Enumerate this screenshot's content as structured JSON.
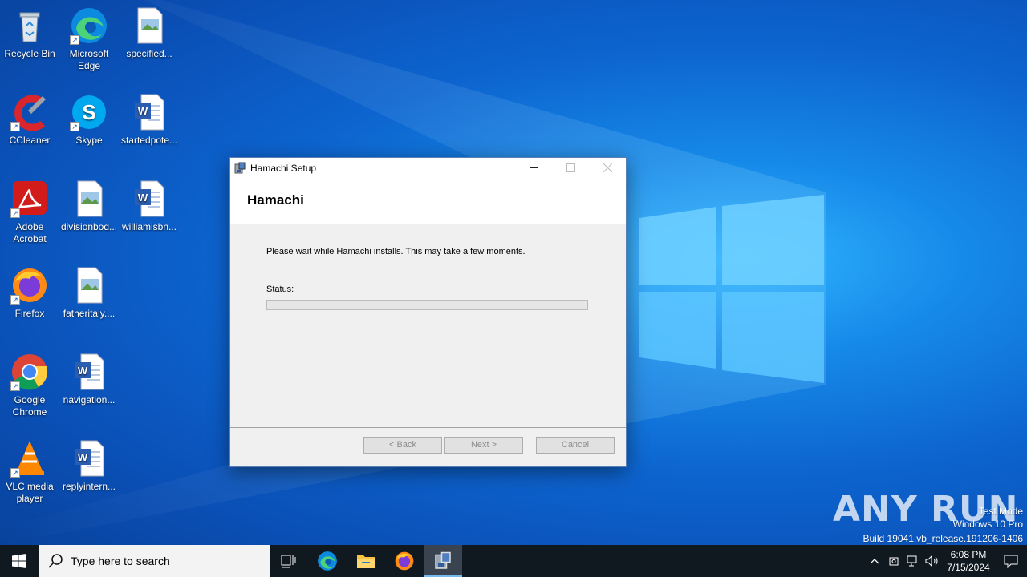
{
  "desktop": {
    "icons": [
      {
        "label": "Recycle Bin",
        "icon": "recycle-bin-icon"
      },
      {
        "label": "Microsoft Edge",
        "icon": "edge-icon"
      },
      {
        "label": "specified...",
        "icon": "image-file-icon"
      },
      {
        "label": "CCleaner",
        "icon": "ccleaner-icon"
      },
      {
        "label": "Skype",
        "icon": "skype-icon"
      },
      {
        "label": "startedpote...",
        "icon": "word-doc-icon"
      },
      {
        "label": "Adobe Acrobat",
        "icon": "acrobat-icon"
      },
      {
        "label": "divisionbod...",
        "icon": "image-file-icon"
      },
      {
        "label": "williamisbn...",
        "icon": "word-doc-icon"
      },
      {
        "label": "Firefox",
        "icon": "firefox-icon"
      },
      {
        "label": "fatheritaly....",
        "icon": "image-file-icon"
      },
      {
        "label": "Google Chrome",
        "icon": "chrome-icon"
      },
      {
        "label": "navigation...",
        "icon": "word-doc-icon"
      },
      {
        "label": "VLC media player",
        "icon": "vlc-icon"
      },
      {
        "label": "replyintern...",
        "icon": "word-doc-icon"
      }
    ]
  },
  "window": {
    "title": "Hamachi Setup",
    "header_title": "Hamachi",
    "message": "Please wait while Hamachi installs. This may take a few moments.",
    "status_label": "Status:",
    "progress": 0,
    "buttons": {
      "back": "< Back",
      "next": "Next >",
      "cancel": "Cancel"
    }
  },
  "taskbar": {
    "search_placeholder": "Type here to search",
    "apps": [
      "task-view-icon",
      "edge-icon",
      "file-explorer-icon",
      "firefox-icon",
      "hamachi-setup-icon"
    ],
    "time": "6:08 PM",
    "date": "7/15/2024"
  },
  "watermark": {
    "line1": "Test Mode",
    "line2": "Windows 10 Pro",
    "line3": "Build 19041.vb_release.191206-1406",
    "brand": "ANY RUN"
  },
  "colors": {
    "accent": "#0078d7",
    "progress_fill": "#06b025",
    "taskbar": "#101820"
  }
}
